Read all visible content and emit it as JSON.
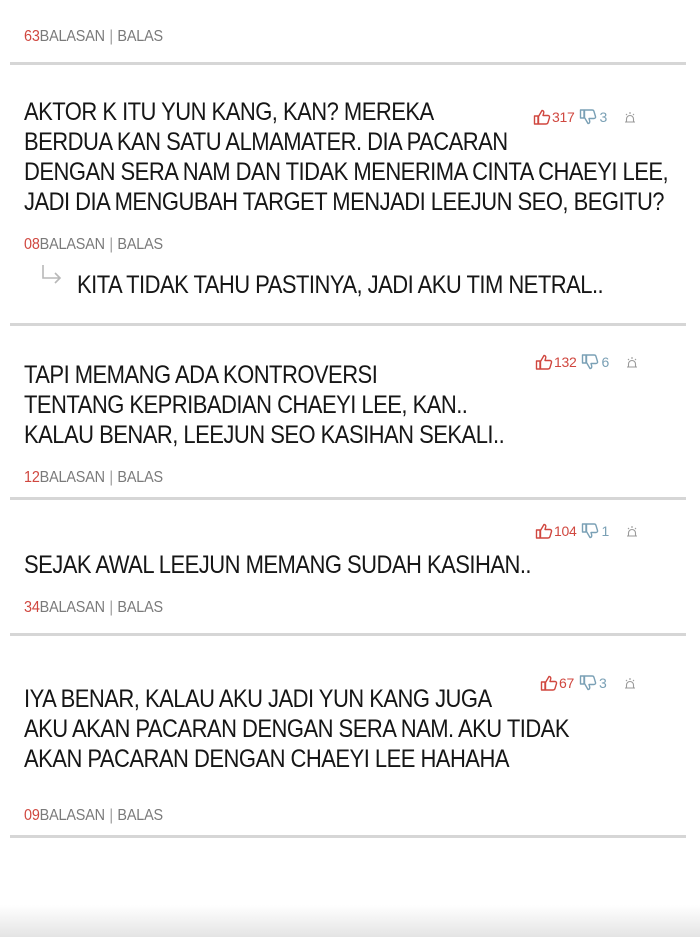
{
  "reply_label": "BALASAN",
  "separator": "|",
  "reply_action": "BALAS",
  "comments": [
    {
      "reply_count": "63"
    },
    {
      "lines": [
        "AKTOR K ITU YUN KANG, KAN?  MEREKA",
        "BERDUA KAN SATU ALMAMATER. DIA PACARAN",
        "DENGAN SERA NAM DAN TIDAK MENERIMA CINTA CHAEYI LEE,",
        "JADI DIA MENGUBAH TARGET MENJADI LEEJUN SEO, BEGITU?"
      ],
      "likes": "317",
      "dislikes": "3",
      "reply_count": "08",
      "reply_text": "KITA TIDAK TAHU PASTINYA, JADI AKU TIM NETRAL.."
    },
    {
      "lines": [
        "TAPI MEMANG ADA KONTROVERSI",
        "TENTANG KEPRIBADIAN CHAEYI LEE, KAN..",
        "KALAU BENAR, LEEJUN SEO KASIHAN SEKALI.."
      ],
      "likes": "132",
      "dislikes": "6",
      "reply_count": "12"
    },
    {
      "lines": [
        "SEJAK AWAL LEEJUN MEMANG SUDAH KASIHAN.."
      ],
      "likes": "104",
      "dislikes": "1",
      "reply_count": "34"
    },
    {
      "lines": [
        "IYA BENAR, KALAU AKU JADI YUN KANG JUGA",
        "AKU AKAN PACARAN DENGAN SERA NAM. AKU TIDAK",
        "AKAN PACARAN DENGAN CHAEYI LEE HAHAHA"
      ],
      "likes": "67",
      "dislikes": "3",
      "reply_count": "09"
    }
  ],
  "colors": {
    "like_red": "#d0473f",
    "dislike_blue": "#7aa0b5",
    "meta_gray": "#7a7a7a",
    "divider": "#d6d6d6"
  },
  "icons": [
    "thumbs-up-icon",
    "thumbs-down-icon",
    "report-icon",
    "reply-arrow-icon"
  ]
}
